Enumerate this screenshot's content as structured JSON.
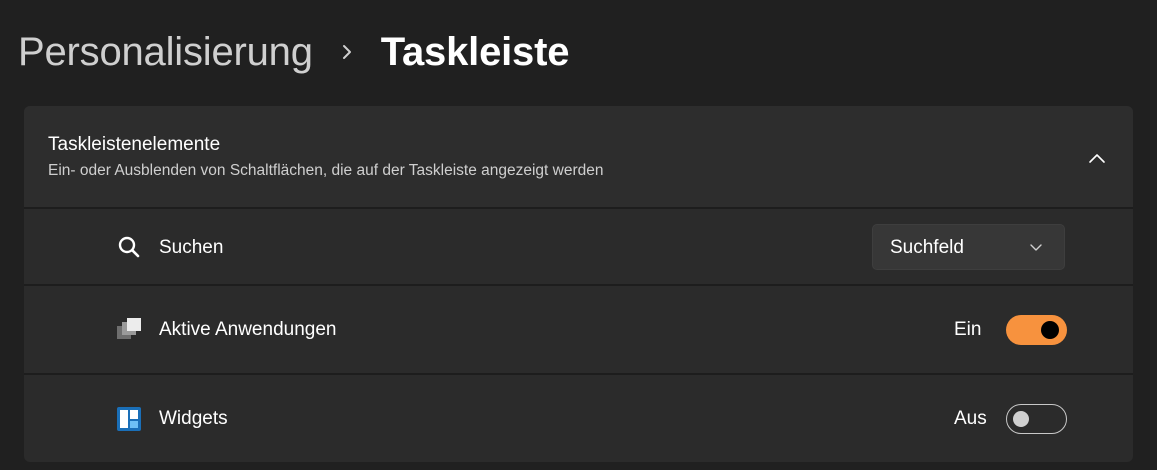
{
  "breadcrumb": {
    "parent": "Personalisierung",
    "separator_icon": "chevron-right-icon",
    "current": "Taskleiste"
  },
  "section": {
    "title": "Taskleistenelemente",
    "description": "Ein- oder Ausblenden von Schaltflächen, die auf der Taskleiste angezeigt werden",
    "collapse_icon": "chevron-up-icon",
    "expanded": true
  },
  "items": [
    {
      "label": "Suchen",
      "icon": "search-icon",
      "control": "dropdown",
      "value": "Suchfeld",
      "dropdown_icon": "chevron-down-icon"
    },
    {
      "label": "Aktive Anwendungen",
      "icon": "task-view-icon",
      "control": "toggle",
      "state_text": "Ein",
      "checked": true
    },
    {
      "label": "Widgets",
      "icon": "widgets-icon",
      "control": "toggle",
      "state_text": "Aus",
      "checked": false
    }
  ],
  "colors": {
    "background": "#202020",
    "card": "#2b2b2b",
    "accent": "#f7923e",
    "widgets_icon": "#3aa0e8"
  }
}
